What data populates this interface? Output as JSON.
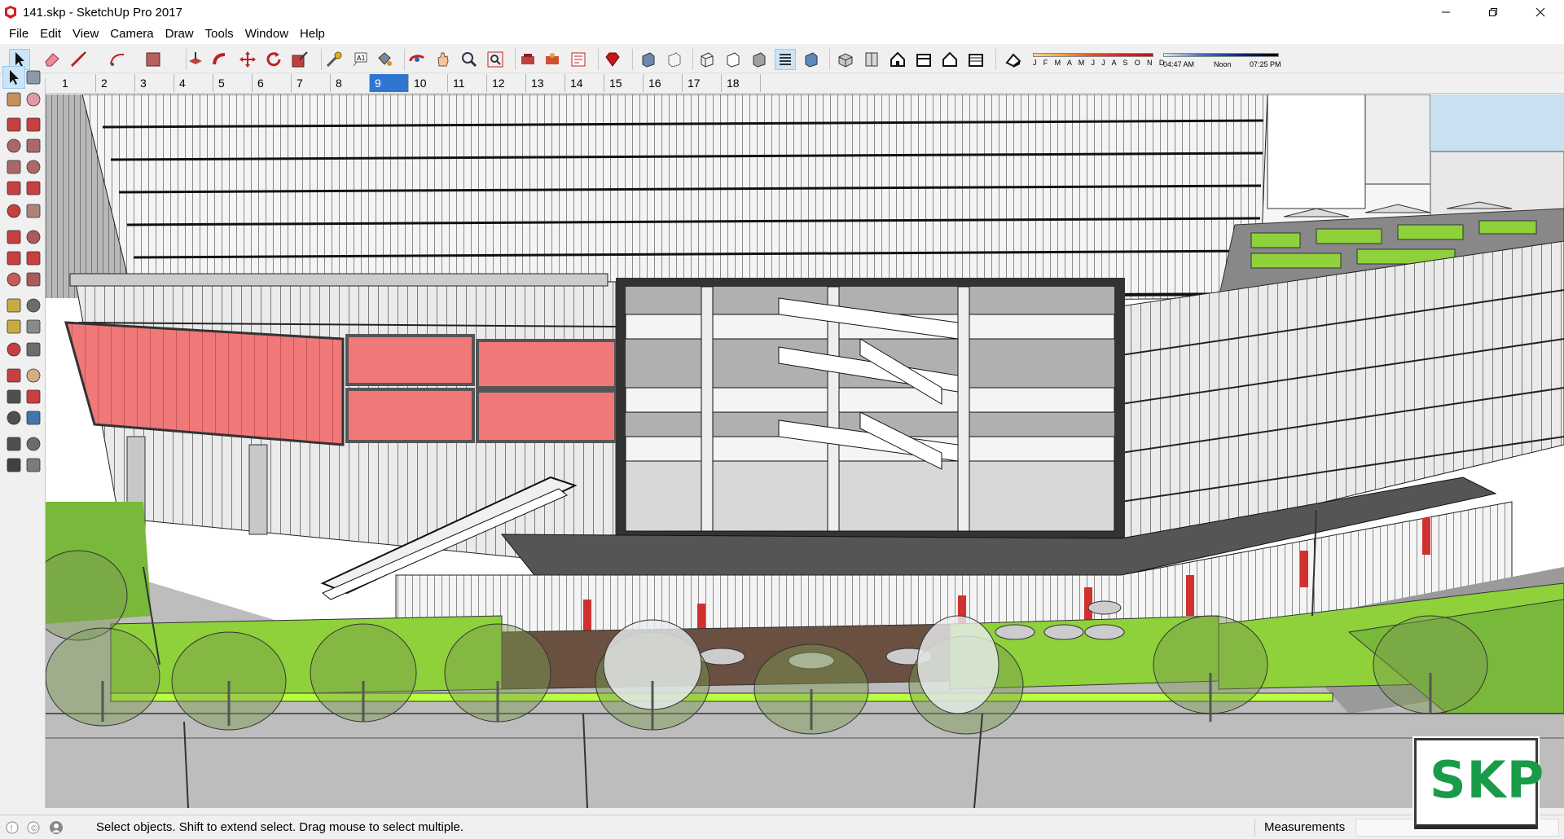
{
  "window": {
    "title": "141.skp - SketchUp Pro 2017",
    "icon": "sketchup-app-icon",
    "controls": [
      "minimize-icon",
      "restore-icon",
      "close-icon"
    ]
  },
  "menu": [
    "File",
    "Edit",
    "View",
    "Camera",
    "Draw",
    "Tools",
    "Window",
    "Help"
  ],
  "toolbar": {
    "groups": [
      [
        "select",
        "eraser",
        "line",
        "arc",
        "rectangle"
      ],
      [
        "push-pull",
        "follow-me",
        "move",
        "rotate",
        "scale"
      ],
      [
        "tape-measure",
        "text",
        "paint-bucket"
      ],
      [
        "orbit",
        "pan",
        "zoom",
        "zoom-extents"
      ],
      [
        "3d-warehouse",
        "extension-warehouse",
        "layout"
      ],
      [
        "ruby-console"
      ],
      [
        "xray",
        "back-edges"
      ],
      [
        "wireframe",
        "hidden-line",
        "shaded",
        "shaded-with-textures",
        "monochrome"
      ],
      [
        "iso-view",
        "top-view",
        "front-view",
        "right-view",
        "back-view",
        "left-view"
      ],
      [
        "shadow-settings"
      ]
    ],
    "active_tool": "select",
    "active_style": "shaded-with-textures"
  },
  "shadows": {
    "months": "J F M A M J J A S O N D",
    "sunrise": "04:47 AM",
    "noon": "Noon",
    "sunset": "07:25 PM"
  },
  "scene_tabs": [
    "1",
    "2",
    "3",
    "4",
    "5",
    "6",
    "7",
    "8",
    "9",
    "10",
    "11",
    "12",
    "13",
    "14",
    "15",
    "16",
    "17",
    "18"
  ],
  "active_scene": "9",
  "palette": [
    "select-tool-icon",
    "component-tool-icon",
    "paint-bucket-icon",
    "eraser-icon",
    "line-tool-icon",
    "freehand-icon",
    "rectangle-icon",
    "rotated-rectangle-icon",
    "circle-icon",
    "polygon-icon",
    "arc-icon",
    "two-point-arc-icon",
    "three-point-arc-icon",
    "pie-icon",
    "move-icon",
    "push-pull-icon",
    "rotate-icon",
    "follow-me-icon",
    "scale-icon",
    "offset-icon",
    "tape-measure-icon",
    "dimension-icon",
    "protractor-icon",
    "text-icon",
    "axes-icon",
    "3d-text-icon",
    "orbit-icon",
    "pan-icon",
    "zoom-icon",
    "zoom-window-icon",
    "zoom-extents-icon",
    "previous-view-icon",
    "position-camera-icon",
    "look-around-icon",
    "walk-icon",
    "section-plane-icon"
  ],
  "status": {
    "hint": "Select objects. Shift to extend select. Drag mouse to select multiple.",
    "measurements_label": "Measurements",
    "measurements_value": ""
  },
  "watermark": "SKP",
  "colors": {
    "accent": "#2f76d2",
    "lawn": "#8ed13a",
    "signage": "#f07878",
    "logo": "#1a9b4a"
  }
}
